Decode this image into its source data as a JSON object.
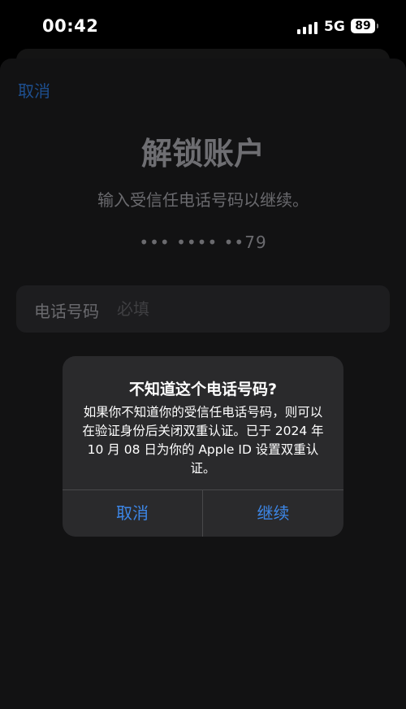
{
  "status_bar": {
    "time": "00:42",
    "network": "5G",
    "battery": "89",
    "icons": [
      "signal-icon",
      "battery-icon"
    ]
  },
  "nav": {
    "cancel_label": "取消"
  },
  "page": {
    "title": "解锁账户",
    "subtitle": "输入受信任电话号码以继续。",
    "masked_number": "••• •••• ••79"
  },
  "phone_field": {
    "label": "电话号码",
    "placeholder": "必填"
  },
  "alert": {
    "title": "不知道这个电话号码?",
    "message": "如果你不知道你的受信任电话号码，则可以在验证身份后关闭双重认证。已于 2024 年 10 月 08 日为你的 Apple ID 设置双重认证。",
    "cancel_label": "取消",
    "continue_label": "继续"
  },
  "colors": {
    "accent": "#3d87e8",
    "dimmed_accent": "#1e4f8f",
    "alert_bg": "#2a2a2c"
  }
}
